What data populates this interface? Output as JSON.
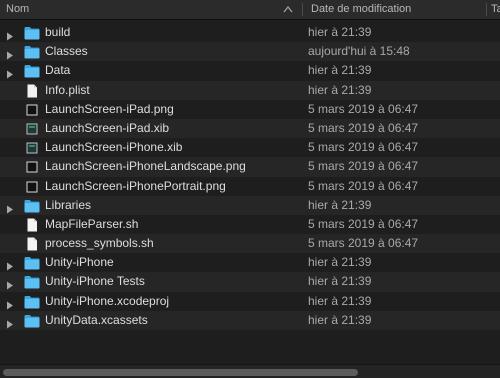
{
  "header": {
    "name_label": "Nom",
    "date_label": "Date de modification",
    "size_label": "Ta"
  },
  "files": [
    {
      "name": "build",
      "date": "hier à 21:39",
      "kind": "folder",
      "icon": "folder-icon"
    },
    {
      "name": "Classes",
      "date": "aujourd'hui à 15:48",
      "kind": "folder",
      "icon": "folder-icon"
    },
    {
      "name": "Data",
      "date": "hier à 21:39",
      "kind": "folder",
      "icon": "folder-icon"
    },
    {
      "name": "Info.plist",
      "date": "hier à 21:39",
      "kind": "file",
      "icon": "document-icon"
    },
    {
      "name": "LaunchScreen-iPad.png",
      "date": "5 mars 2019 à 06:47",
      "kind": "file",
      "icon": "image-file-icon"
    },
    {
      "name": "LaunchScreen-iPad.xib",
      "date": "5 mars 2019 à 06:47",
      "kind": "file",
      "icon": "xib-file-icon"
    },
    {
      "name": "LaunchScreen-iPhone.xib",
      "date": "5 mars 2019 à 06:47",
      "kind": "file",
      "icon": "xib-file-icon"
    },
    {
      "name": "LaunchScreen-iPhoneLandscape.png",
      "date": "5 mars 2019 à 06:47",
      "kind": "file",
      "icon": "image-file-icon"
    },
    {
      "name": "LaunchScreen-iPhonePortrait.png",
      "date": "5 mars 2019 à 06:47",
      "kind": "file",
      "icon": "image-file-icon"
    },
    {
      "name": "Libraries",
      "date": "hier à 21:39",
      "kind": "folder",
      "icon": "folder-icon"
    },
    {
      "name": "MapFileParser.sh",
      "date": "5 mars 2019 à 06:47",
      "kind": "file",
      "icon": "document-icon"
    },
    {
      "name": "process_symbols.sh",
      "date": "5 mars 2019 à 06:47",
      "kind": "file",
      "icon": "document-icon"
    },
    {
      "name": "Unity-iPhone",
      "date": "hier à 21:39",
      "kind": "folder",
      "icon": "folder-icon"
    },
    {
      "name": "Unity-iPhone Tests",
      "date": "hier à 21:39",
      "kind": "folder",
      "icon": "folder-icon"
    },
    {
      "name": "Unity-iPhone.xcodeproj",
      "date": "hier à 21:39",
      "kind": "folder",
      "icon": "folder-icon"
    },
    {
      "name": "UnityData.xcassets",
      "date": "hier à 21:39",
      "kind": "folder",
      "icon": "folder-icon"
    }
  ],
  "colors": {
    "folder": "#3aa7e0",
    "background": "#1e1e1e",
    "alt_row": "#262626"
  }
}
